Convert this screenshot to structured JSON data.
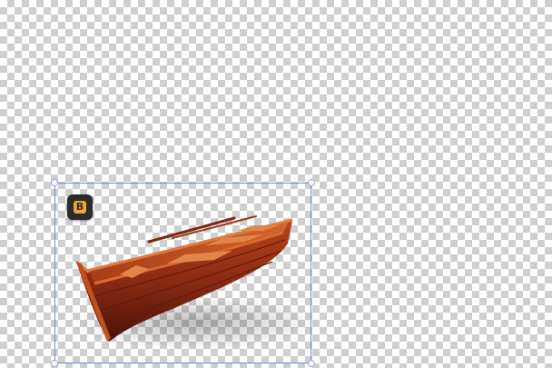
{
  "canvas": {
    "background": "transparency-checkerboard",
    "checker_color_light": "#ffffff",
    "checker_color_dark": "#cfcfcf"
  },
  "selection": {
    "border_color": "#6b8fd6",
    "handle_color": "#ffffff"
  },
  "badge": {
    "icon": "app-logo-icon",
    "glyph": "B",
    "background": "#2b2b2b",
    "accent": "#f0a72b"
  },
  "image_object": {
    "subject": "rowboat",
    "hull_color": "#8a2a12",
    "wood_color": "#c4582a",
    "rim_color": "#d86a2e"
  }
}
